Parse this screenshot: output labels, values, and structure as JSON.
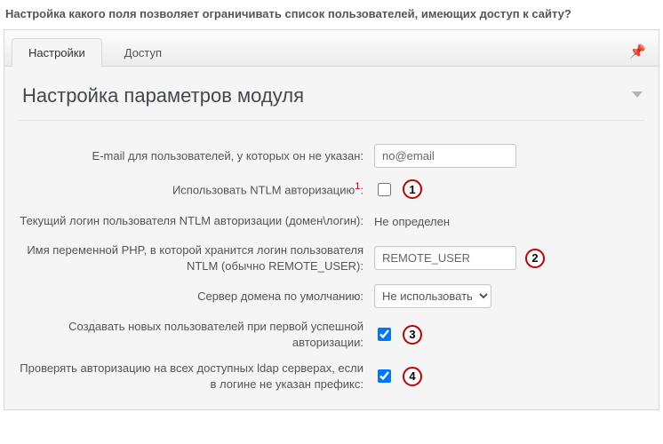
{
  "question": "Настройка какого поля позволяет ограничивать список пользователей, имеющих доступ к сайту?",
  "tabs": {
    "settings": "Настройки",
    "access": "Доступ"
  },
  "section_title": "Настройка параметров модуля",
  "fields": {
    "email_label": "E-mail для пользователей, у которых он не указан:",
    "email_value": "no@email",
    "ntlm_label": "Использовать NTLM авторизацию",
    "ntlm_footnote": "1",
    "ntlm_colon": ":",
    "current_login_label": "Текущий логин пользователя NTLM авторизации (домен\\логин):",
    "current_login_value": "Не определен",
    "php_var_label": "Имя переменной PHP, в которой хранится логин пользователя NTLM (обычно REMOTE_USER):",
    "php_var_value": "REMOTE_USER",
    "domain_server_label": "Сервер домена по умолчанию:",
    "domain_server_value": "Не использовать",
    "create_users_label": "Создавать новых пользователей при первой успешной авторизации:",
    "check_ldap_label": "Проверять авторизацию на всех доступных ldap серверах, если в логине не указан префикс:"
  },
  "badges": {
    "b1": "1",
    "b2": "2",
    "b3": "3",
    "b4": "4"
  }
}
